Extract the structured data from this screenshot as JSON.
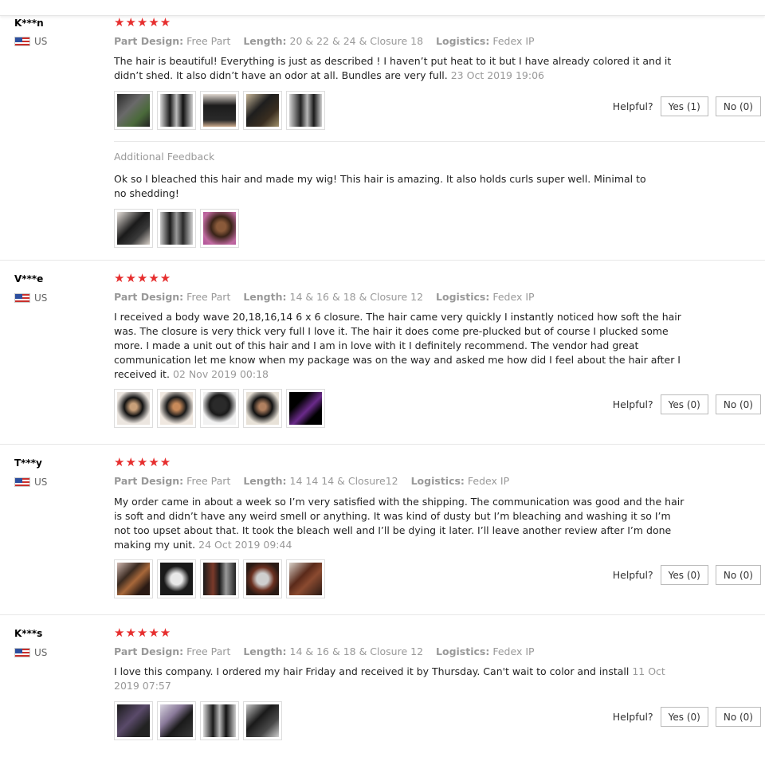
{
  "helpful_label": "Helpful?",
  "reviews": [
    {
      "user": "K***n",
      "country": "US",
      "stars": "★★★★★",
      "attrs": [
        {
          "label": "Part Design:",
          "value": "Free Part"
        },
        {
          "label": "Length:",
          "value": "20 & 22 & 24 & Closure 18"
        },
        {
          "label": "Logistics:",
          "value": "Fedex IP"
        }
      ],
      "text": "The hair is beautiful! Everything is just as described ! I haven’t put heat to it but I have already colored it and it didn’t shed. It also didn’t have an odor at all. Bundles are very full.",
      "date": "23 Oct 2019 19:06",
      "yes": "Yes (1)",
      "no": "No (0)",
      "additional": {
        "title": "Additional Feedback",
        "text": "Ok so I bleached this hair and made my wig! This hair is amazing. It also holds curls super well. Minimal to no shedding!"
      }
    },
    {
      "user": "V***e",
      "country": "US",
      "stars": "★★★★★",
      "attrs": [
        {
          "label": "Part Design:",
          "value": "Free Part"
        },
        {
          "label": "Length:",
          "value": "14 & 16 & 18 & Closure 12"
        },
        {
          "label": "Logistics:",
          "value": "Fedex IP"
        }
      ],
      "text": "I received a body wave 20,18,16,14 6 x 6 closure. The hair came very quickly I instantly noticed how soft the hair was. The closure is very thick very full I love it. The hair it does come pre-plucked but of course I plucked some more. I made a unit out of this hair and I am in love with it I definitely recommend. The vendor had great communication let me know when my package was on the way and asked me how did I feel about the hair after I received it.",
      "date": "02 Nov 2019 00:18",
      "yes": "Yes (0)",
      "no": "No (0)"
    },
    {
      "user": "T***y",
      "country": "US",
      "stars": "★★★★★",
      "attrs": [
        {
          "label": "Part Design:",
          "value": "Free Part"
        },
        {
          "label": "Length:",
          "value": "14 14 14 & Closure12"
        },
        {
          "label": "Logistics:",
          "value": "Fedex IP"
        }
      ],
      "text": "My order came in about a week so I’m very satisfied with the shipping. The communication was good and the hair is soft and didn’t have any weird smell or anything. It was kind of dusty but I’m bleaching and washing it so I’m not too upset about that. It took the bleach well and I’ll be dying it later. I’ll leave another review after I’m done making my unit.",
      "date": "24 Oct 2019 09:44",
      "yes": "Yes (0)",
      "no": "No (0)"
    },
    {
      "user": "K***s",
      "country": "US",
      "stars": "★★★★★",
      "attrs": [
        {
          "label": "Part Design:",
          "value": "Free Part"
        },
        {
          "label": "Length:",
          "value": "14 & 16 & 18 & Closure 12"
        },
        {
          "label": "Logistics:",
          "value": "Fedex IP"
        }
      ],
      "text": "I love this company. I ordered my hair Friday and received it by Thursday. Can't wait to color and install",
      "date": "11 Oct 2019 07:57",
      "yes": "Yes (0)",
      "no": "No (0)"
    }
  ]
}
